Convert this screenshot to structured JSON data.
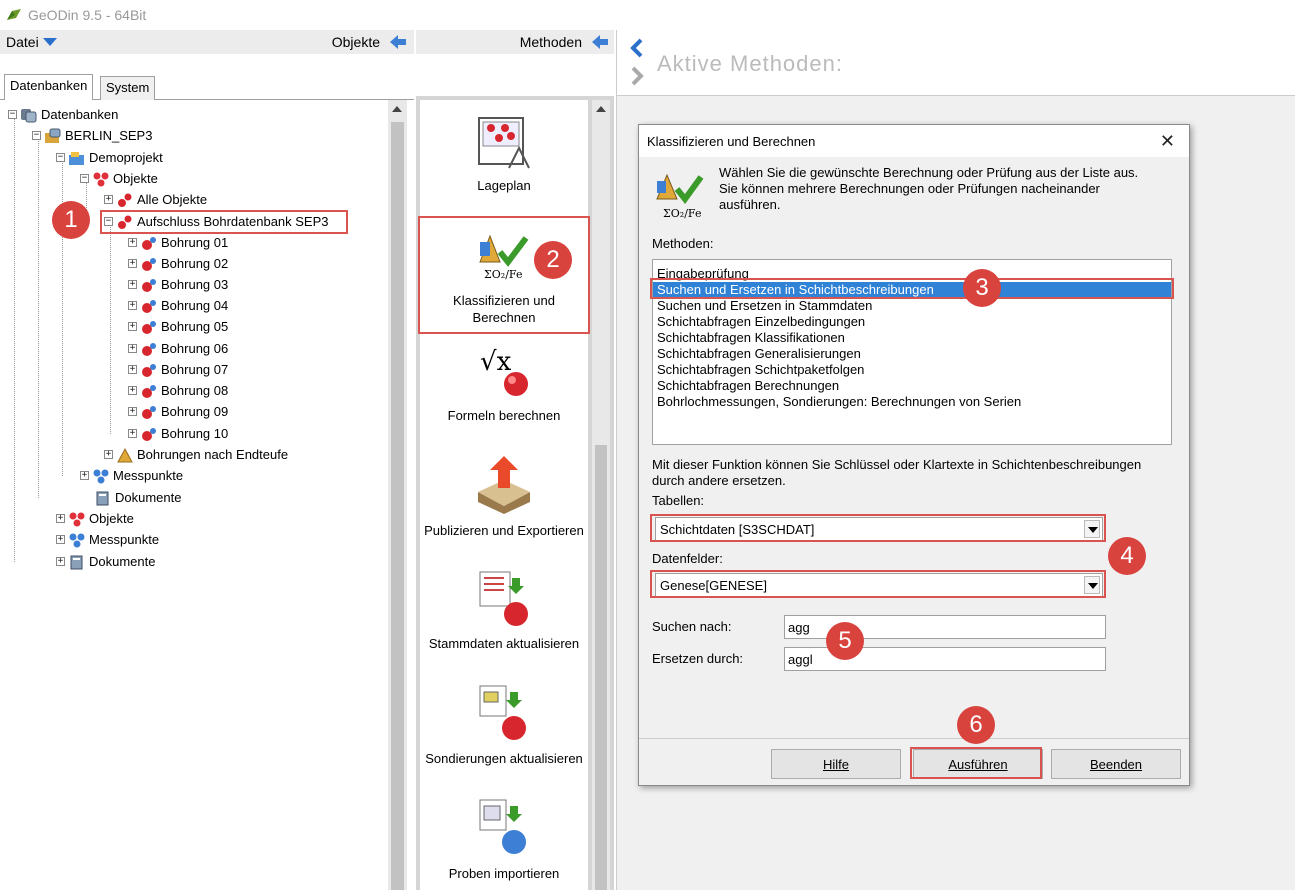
{
  "window": {
    "title": "GeODin 9.5  - 64Bit"
  },
  "left_header": {
    "menu_label": "Datei",
    "objects_label": "Objekte"
  },
  "tabs": [
    "Datenbanken",
    "System"
  ],
  "tree": {
    "root": "Datenbanken",
    "database": "BERLIN_SEP3",
    "project": "Demoprojekt",
    "objects": "Objekte",
    "all_objects": "Alle Objekte",
    "selected_object": "Aufschluss Bohrdatenbank SEP3",
    "bohrungen": [
      "Bohrung 01",
      "Bohrung 02",
      "Bohrung 03",
      "Bohrung 04",
      "Bohrung 05",
      "Bohrung 06",
      "Bohrung 07",
      "Bohrung 08",
      "Bohrung 09",
      "Bohrung 10"
    ],
    "bohrungen_endteufe": "Bohrungen nach Endteufe",
    "messpunkte": "Messpunkte",
    "dokumente": "Dokumente",
    "top_objekte": "Objekte",
    "top_messpunkte": "Messpunkte",
    "top_dokumente": "Dokumente"
  },
  "methods_header": {
    "label": "Methoden"
  },
  "methods": [
    {
      "label": "Lageplan",
      "icon": "map-plan-icon"
    },
    {
      "label": "Klassifizieren und Berechnen",
      "icon": "classify-calc-icon"
    },
    {
      "label": "Formeln berechnen",
      "icon": "formula-icon"
    },
    {
      "label": "Publizieren und Exportieren",
      "icon": "publish-export-icon"
    },
    {
      "label": "Stammdaten aktualisieren",
      "icon": "update-masterdata-icon"
    },
    {
      "label": "Sondierungen aktualisieren",
      "icon": "update-soundings-icon"
    },
    {
      "label": "Proben importieren",
      "icon": "import-samples-icon"
    }
  ],
  "right": {
    "heading": "Aktive Methoden:"
  },
  "dialog": {
    "title": "Klassifizieren und Berechnen",
    "description": "Wählen Sie die gewünschte Berechnung oder Prüfung aus der Liste aus. Sie können mehrere Berechnungen oder Prüfungen nacheinander ausführen.",
    "methods_label": "Methoden:",
    "methods_list": [
      "Eingabeprüfung",
      "Suchen und Ersetzen in Schichtbeschreibungen",
      "Suchen und Ersetzen in Stammdaten",
      "Schichtabfragen Einzelbedingungen",
      "Schichtabfragen Klassifikationen",
      "Schichtabfragen Generalisierungen",
      "Schichtabfragen Schichtpaketfolgen",
      "Schichtabfragen Berechnungen",
      "Bohrlochmessungen, Sondierungen: Berechnungen von Serien"
    ],
    "selected_index": 1,
    "function_text": "Mit dieser Funktion können Sie Schlüssel oder Klartexte in Schichtenbeschreibungen durch andere ersetzen.",
    "tables_label": "Tabellen:",
    "tables_value": "Schichtdaten [S3SCHDAT]",
    "fields_label": "Datenfelder:",
    "fields_value": "Genese[GENESE]",
    "search_label": "Suchen nach:",
    "search_value": "agg",
    "replace_label": "Ersetzen durch:",
    "replace_value": "aggl",
    "buttons": {
      "help": "Hilfe",
      "run": "Ausführen",
      "close": "Beenden"
    }
  },
  "badges": [
    "1",
    "2",
    "3",
    "4",
    "5",
    "6"
  ],
  "colors": {
    "highlight": "#d9534f",
    "selection": "#2f82d6",
    "badge": "#d9433e"
  }
}
